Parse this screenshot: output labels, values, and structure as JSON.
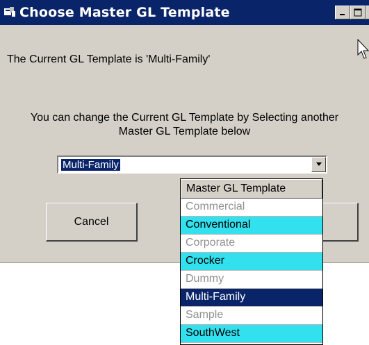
{
  "window": {
    "title": "Choose Master GL Template",
    "current_message": "The Current GL Template is 'Multi-Family'",
    "change_message_line1": "You can change the Current GL Template by Selecting another",
    "change_message_line2": "Master GL Template below"
  },
  "combo": {
    "selected_value": "Multi-Family"
  },
  "buttons": {
    "cancel_label": "Cancel"
  },
  "dropdown": {
    "header": "Master GL Template",
    "items": [
      {
        "label": "Commercial",
        "style": "inactive"
      },
      {
        "label": "Conventional",
        "style": "cyan"
      },
      {
        "label": "Corporate",
        "style": "inactive"
      },
      {
        "label": "Crocker",
        "style": "cyan"
      },
      {
        "label": "Dummy",
        "style": "inactive"
      },
      {
        "label": "Multi-Family",
        "style": "selected"
      },
      {
        "label": "Sample",
        "style": "inactive"
      },
      {
        "label": "SouthWest",
        "style": "cyan"
      }
    ]
  },
  "colors": {
    "titlebar": "#0a246a",
    "dialog_bg": "#d4d0c8",
    "highlight_cyan": "#33e0ee",
    "selection": "#0a246a"
  },
  "icons": [
    "app-icon",
    "minimize-icon",
    "maximize-icon",
    "close-icon",
    "dropdown-arrow-icon",
    "mouse-cursor-icon"
  ]
}
